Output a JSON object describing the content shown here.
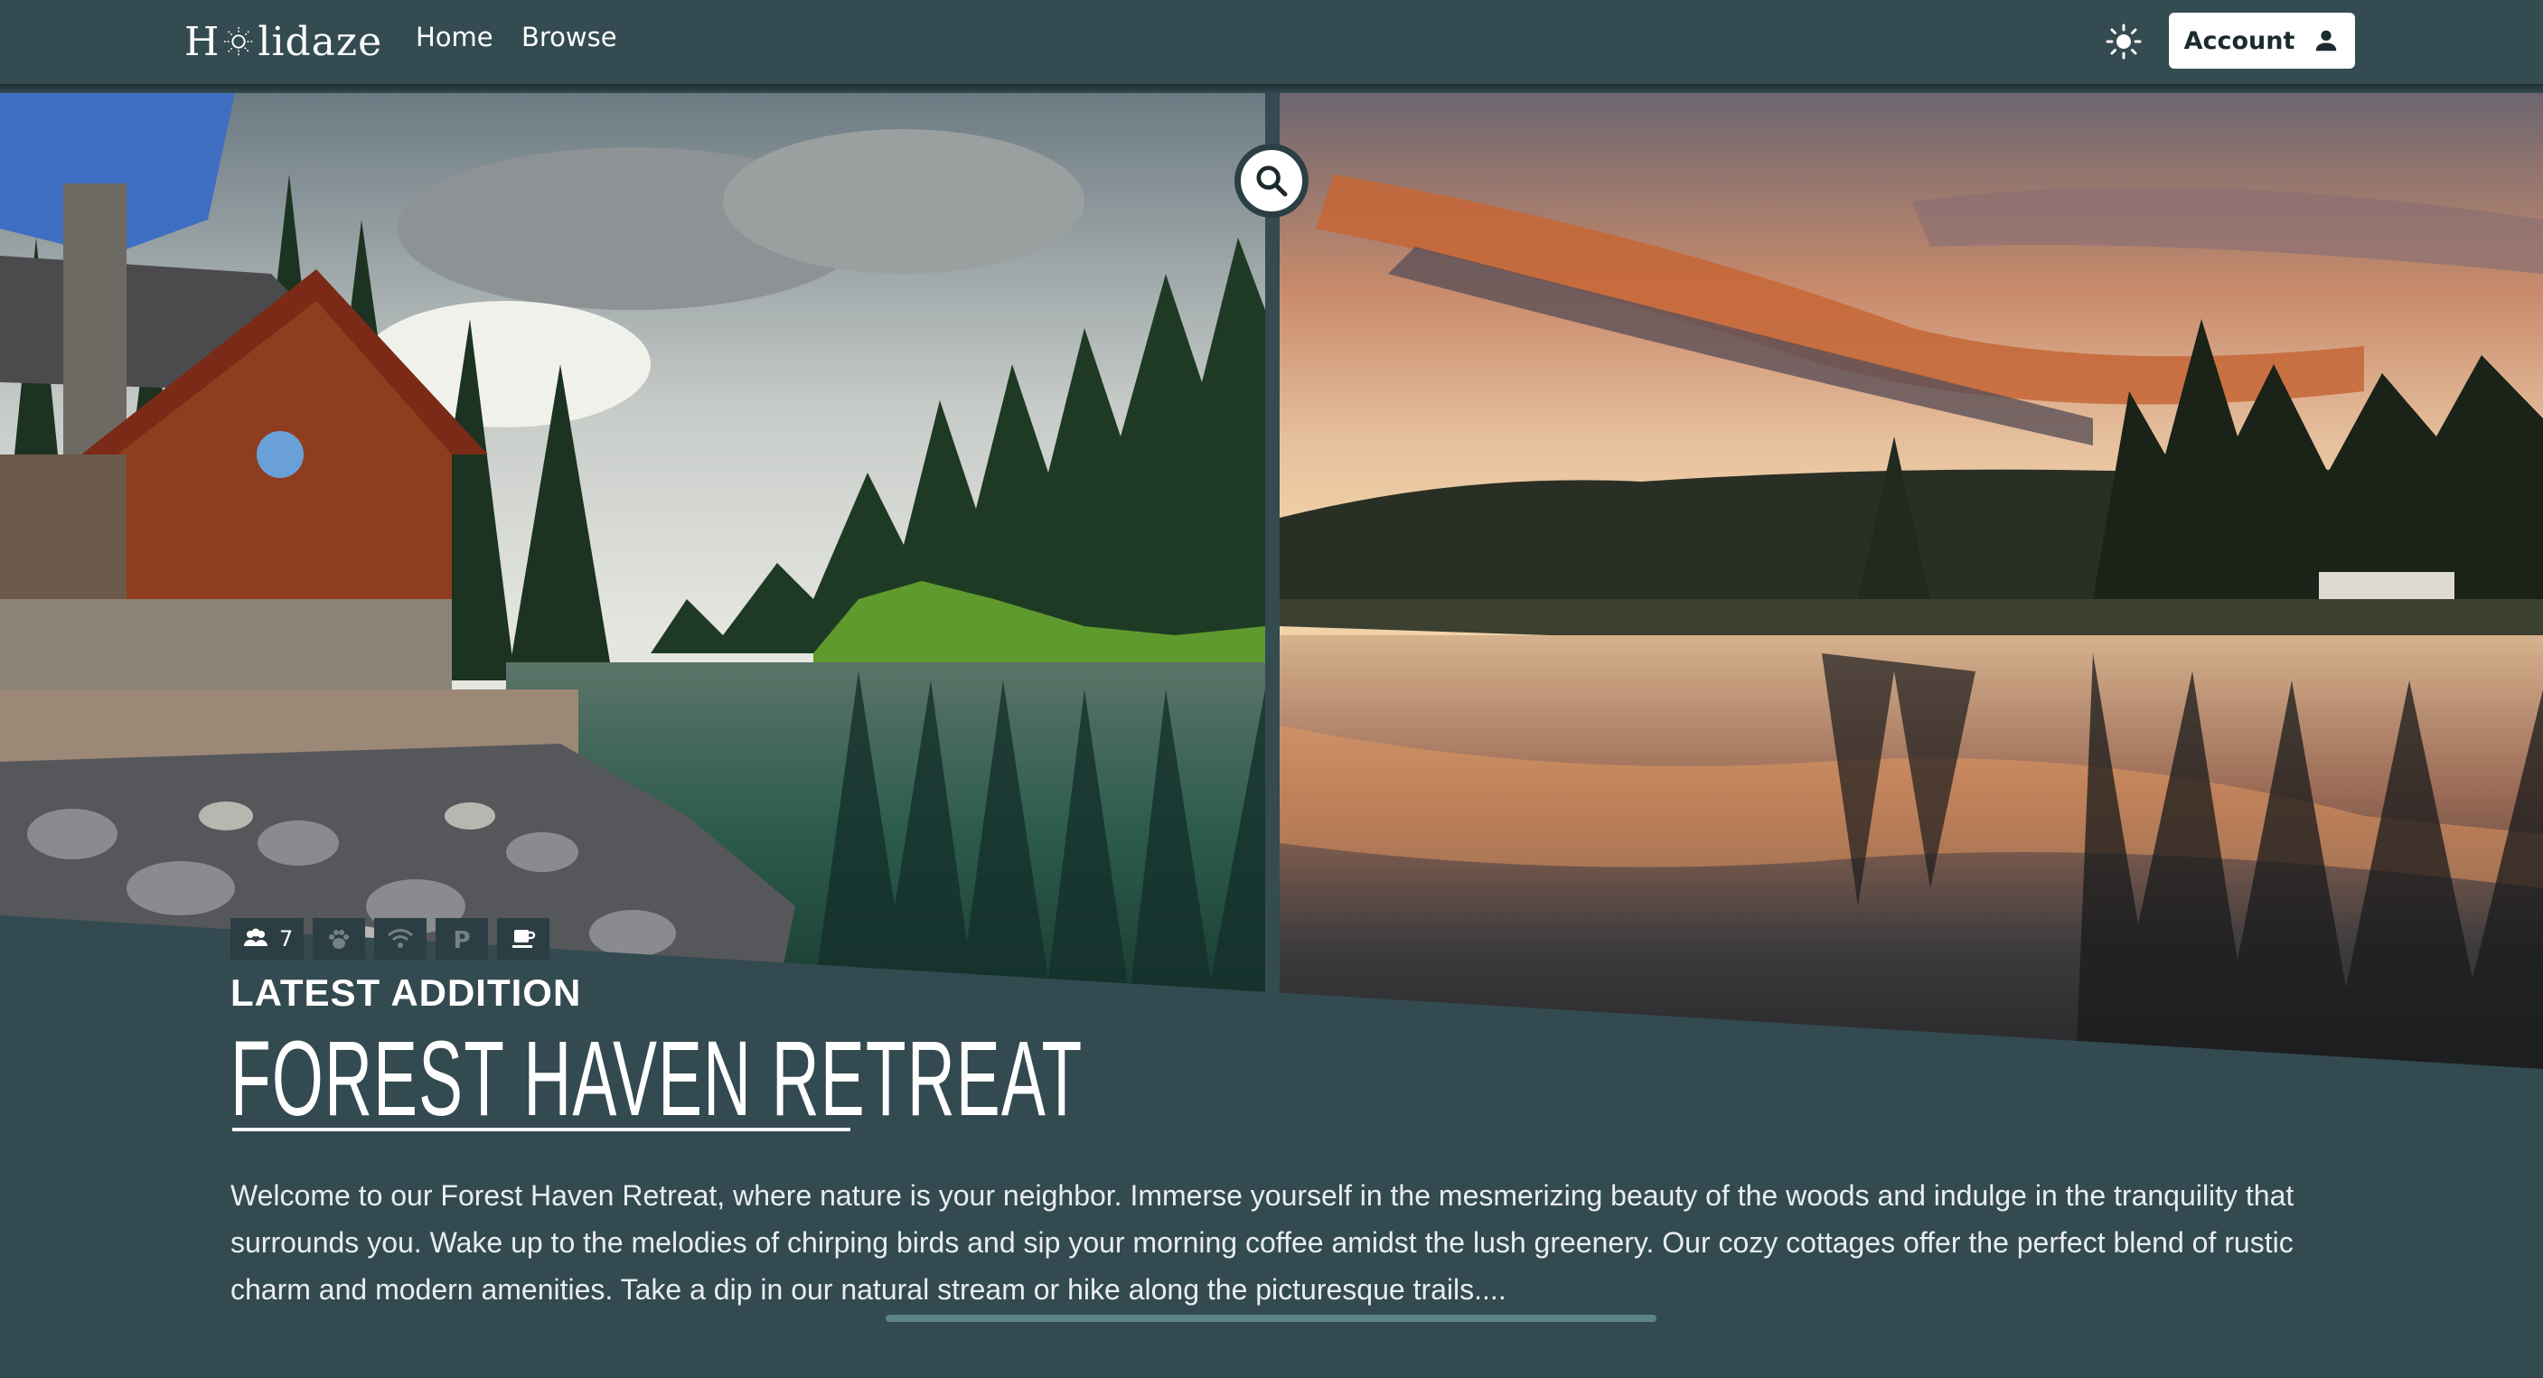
{
  "navbar": {
    "logo_text_left": "H",
    "logo_text_right": "lidaze",
    "links": [
      {
        "label": "Home"
      },
      {
        "label": "Browse"
      }
    ],
    "account_label": "Account"
  },
  "icons": {
    "logo": "sun-logo-icon",
    "theme_toggle": "sun-icon",
    "account": "person-icon",
    "search": "search-icon"
  },
  "feature": {
    "amenities": [
      {
        "icon": "guests-icon",
        "label": "7",
        "available": true
      },
      {
        "icon": "paw-icon",
        "available": false
      },
      {
        "icon": "wifi-icon",
        "available": false
      },
      {
        "icon": "parking-icon",
        "label": "P",
        "available": false
      },
      {
        "icon": "coffee-icon",
        "available": true
      }
    ],
    "eyebrow": "LATEST ADDITION",
    "title": "FOREST HAVEN RETREAT",
    "description": "Welcome to our Forest Haven Retreat, where nature is your neighbor. Immerse yourself in the mesmerizing beauty of the woods and indulge in the tranquility that surrounds you. Wake up to the melodies of chirping birds and sip your morning coffee amidst the lush greenery. Our cozy cottages offer the perfect blend of rustic charm and modern amenities. Take a dip in our natural stream or hike along the picturesque trails...."
  },
  "colors": {
    "background": "#334a50",
    "accent": "#5d8485"
  }
}
